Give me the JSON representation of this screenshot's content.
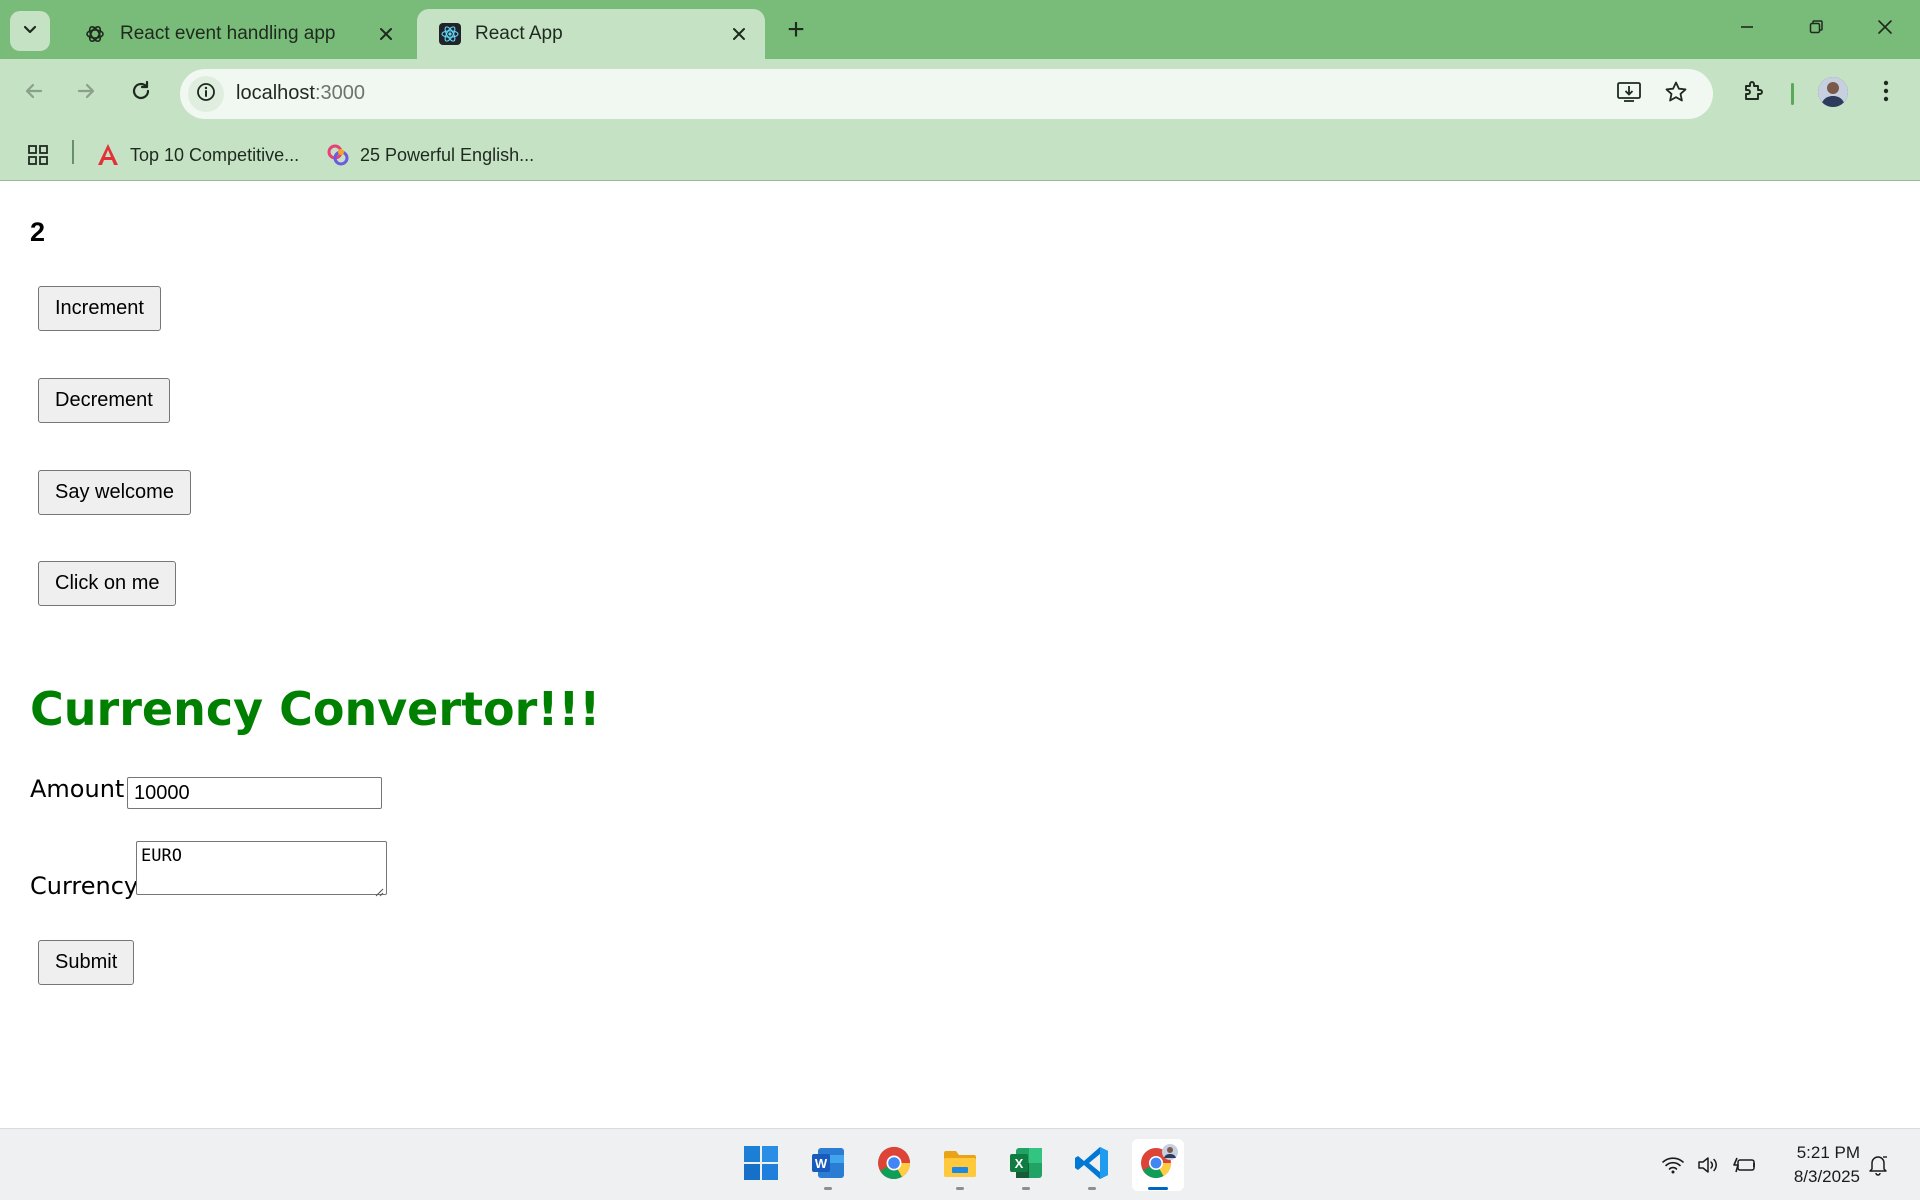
{
  "browser": {
    "tabs": [
      {
        "title": "React event handling app",
        "favicon": "openai-icon",
        "active": false
      },
      {
        "title": "React App",
        "favicon": "react-icon",
        "active": true
      }
    ],
    "new_tab_symbol": "+",
    "address": {
      "host": "localhost",
      "port": ":3000"
    },
    "bookmarks": [
      {
        "label": "Top 10 Competitive...",
        "icon": "angular-icon"
      },
      {
        "label": "25 Powerful English...",
        "icon": "copilot-icon"
      }
    ],
    "colors": {
      "frame": "#79bb78",
      "toolbar": "#c5e2c5"
    }
  },
  "page": {
    "counter": "2",
    "buttons": {
      "increment": "Increment",
      "decrement": "Decrement",
      "say_welcome": "Say welcome",
      "click_on_me": "Click on me",
      "submit": "Submit"
    },
    "converter": {
      "title": "Currency Convertor!!!",
      "title_color": "#008000",
      "amount_label": "Amount:",
      "amount_value": "10000",
      "currency_label": "Currency:",
      "currency_value": "EURO"
    }
  },
  "taskbar": {
    "apps": [
      "windows-start-icon",
      "word-icon",
      "chrome-icon",
      "file-explorer-icon",
      "excel-icon",
      "vscode-icon",
      "chrome-profile-icon"
    ],
    "time": "5:21 PM",
    "date": "8/3/2025"
  }
}
